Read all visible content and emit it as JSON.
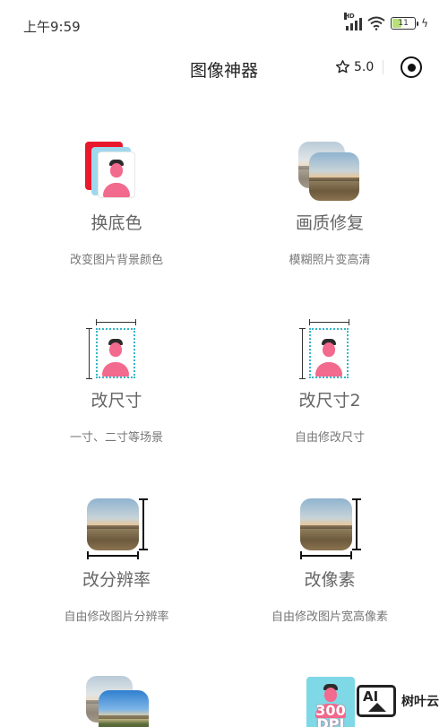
{
  "status_bar": {
    "time": "上午9:59",
    "network": "HD",
    "battery": "11"
  },
  "nav": {
    "title": "图像神器",
    "rating": "5.0"
  },
  "tools": [
    {
      "name": "换底色",
      "desc": "改变图片背景颜色"
    },
    {
      "name": "画质修复",
      "desc": "模糊照片变高清"
    },
    {
      "name": "改尺寸",
      "desc": "一寸、二寸等场景"
    },
    {
      "name": "改尺寸2",
      "desc": "自由修改尺寸"
    },
    {
      "name": "改分辨率",
      "desc": "自由修改图片分辨率"
    },
    {
      "name": "改像素",
      "desc": "自由修改图片宽高像素"
    }
  ],
  "partial_tools": {
    "dpi_label": "300 DPI"
  },
  "watermark": {
    "logo": "AI",
    "text": "树叶云"
  },
  "colors": {
    "accent_pink": "#f26a8d",
    "frame_teal": "#38b6c8",
    "text_gray": "#666666"
  }
}
